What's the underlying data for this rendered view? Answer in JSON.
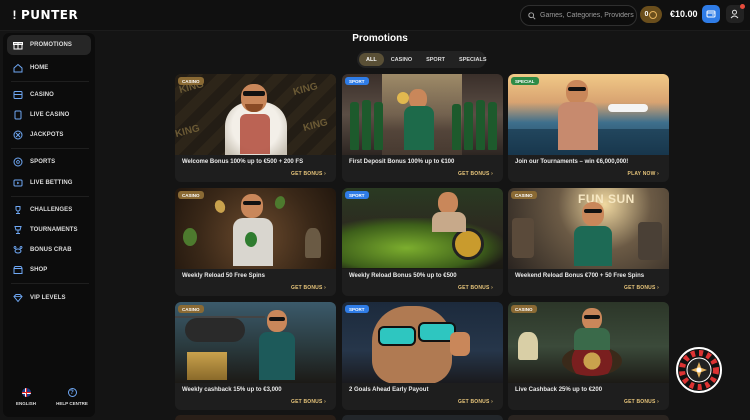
{
  "brand": {
    "logo_text": "PUNTER",
    "logo_mark": "!"
  },
  "header": {
    "search_placeholder": "Games, Categories, Providers",
    "coins_value": "0",
    "balance": "€10.00",
    "icons": {
      "search": "search-icon",
      "coin": "coin-icon",
      "wallet": "wallet-icon",
      "account": "account-icon"
    },
    "accent": "#2f7ce6"
  },
  "sidebar": {
    "items": [
      {
        "label": "PROMOTIONS",
        "icon": "gift-icon",
        "active": true
      },
      {
        "label": "HOME",
        "icon": "home-icon"
      },
      {
        "label": "CASINO",
        "icon": "slot-machine-icon"
      },
      {
        "label": "LIVE CASINO",
        "icon": "cards-icon"
      },
      {
        "label": "JACKPOTS",
        "icon": "jackpot-icon"
      },
      {
        "label": "SPORTS",
        "icon": "football-icon"
      },
      {
        "label": "LIVE BETTING",
        "icon": "tv-icon"
      },
      {
        "label": "CHALLENGES",
        "icon": "trophy-icon"
      },
      {
        "label": "TOURNAMENTS",
        "icon": "cup-icon"
      },
      {
        "label": "BONUS CRAB",
        "icon": "crab-icon"
      },
      {
        "label": "SHOP",
        "icon": "shop-icon"
      },
      {
        "label": "VIP LEVELS",
        "icon": "diamond-icon"
      }
    ],
    "footer": [
      {
        "label": "ENGLISH",
        "icon": "uk-flag-icon"
      },
      {
        "label": "HELP CENTRE",
        "icon": "help-icon"
      }
    ]
  },
  "main": {
    "title": "Promotions",
    "tabs": [
      {
        "label": "ALL",
        "active": true
      },
      {
        "label": "CASINO"
      },
      {
        "label": "SPORT"
      },
      {
        "label": "SPECIALS"
      }
    ],
    "cards": [
      {
        "badge": "CASINO",
        "badge_type": "casino",
        "title": "Welcome Bonus 100% up to €500 + 200 FS",
        "cta": "GET BONUS",
        "theme": "king"
      },
      {
        "badge": "SPORT",
        "badge_type": "sport",
        "title": "First Deposit Bonus 100% up to €100",
        "cta": "GET BONUS",
        "theme": "champagne"
      },
      {
        "badge": "SPECIAL",
        "badge_type": "special",
        "title": "Join our Tournaments – win €6,000,000!",
        "cta": "PLAY NOW",
        "theme": "yacht"
      },
      {
        "badge": "CASINO",
        "badge_type": "casino",
        "title": "Weekly Reload 50 Free Spins",
        "cta": "GET BONUS",
        "theme": "eggs"
      },
      {
        "badge": "SPORT",
        "badge_type": "sport",
        "title": "Weekly Reload Bonus 50% up to €500",
        "cta": "GET BONUS",
        "theme": "car"
      },
      {
        "badge": "CASINO",
        "badge_type": "casino",
        "title": "Weekend Reload Bonus €700 + 50 Free Spins",
        "cta": "GET BONUS",
        "theme": "funsun"
      },
      {
        "badge": "CASINO",
        "badge_type": "casino",
        "title": "Weekly cashback 15% up to €3,000",
        "cta": "GET BONUS",
        "theme": "helicopter"
      },
      {
        "badge": "SPORT",
        "badge_type": "sport",
        "title": "2 Goals Ahead Early Payout",
        "cta": "GET BONUS",
        "theme": "glasses"
      },
      {
        "badge": "CASINO",
        "badge_type": "casino",
        "title": "Live Cashback 25% up to €200",
        "cta": "GET BONUS",
        "theme": "roulette"
      }
    ],
    "card_image_text": {
      "king": "KING",
      "funsun": "FUN SUN"
    }
  },
  "floating": {
    "icon": "roulette-wheel-icon"
  }
}
